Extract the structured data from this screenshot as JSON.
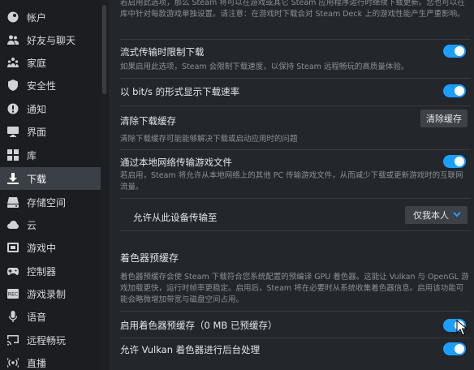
{
  "sidebar": {
    "items": [
      {
        "label": "帐户",
        "icon": "steam-logo-icon"
      },
      {
        "label": "好友与聊天",
        "icon": "friends-icon"
      },
      {
        "label": "家庭",
        "icon": "family-icon"
      },
      {
        "label": "安全性",
        "icon": "shield-icon"
      },
      {
        "label": "通知",
        "icon": "notification-icon"
      },
      {
        "label": "界面",
        "icon": "monitor-icon"
      },
      {
        "label": "库",
        "icon": "grid-icon"
      },
      {
        "label": "下载",
        "icon": "download-icon",
        "active": true
      },
      {
        "label": "存储空间",
        "icon": "drive-icon"
      },
      {
        "label": "云",
        "icon": "cloud-icon"
      },
      {
        "label": "游戏中",
        "icon": "in-game-icon"
      },
      {
        "label": "控制器",
        "icon": "controller-icon"
      },
      {
        "label": "游戏录制",
        "icon": "record-icon"
      },
      {
        "label": "语音",
        "icon": "microphone-icon"
      },
      {
        "label": "远程畅玩",
        "icon": "remote-play-icon"
      },
      {
        "label": "直播",
        "icon": "broadcast-icon"
      }
    ]
  },
  "settings": {
    "top_desc": "若启用此选项，那么 Steam 将可以在游戏或其它 Steam 应用程序运行时继续下载更新。您也可以在库中针对每款游戏单独设置。请注意：在游戏时下载会对 Steam Deck 上的游戏性能产生严重影响。",
    "stream_throttle": {
      "title": "流式传输时限制下载",
      "desc": "如果启用此选项，Steam 会限制下载速度，以保持 Steam 远程畅玩的高质量体验。"
    },
    "bits_display": {
      "title": "以 bit/s 的形式显示下载速率"
    },
    "clear_cache": {
      "title": "清除下载缓存",
      "button": "清除缓存",
      "desc": "清除下载缓存可能能够解决下载或启动应用时的问题"
    },
    "lan_transfer": {
      "title": "通过本地网络传输游戏文件",
      "desc": "若启用，Steam 将允许从本地网络上的其他 PC 传输游戏文件，从而减少下载或更新游戏时的互联网流量。"
    },
    "allow_transfer": {
      "title": "允许从此设备传输至",
      "value": "仅我本人"
    },
    "shader": {
      "section": "着色器预缓存",
      "desc": "着色器预缓存会使 Steam 下载符合您系统配置的预编译 GPU 着色器。这能让 Vulkan 与 OpenGL 游戏加载更快，运行时帧率更稳定。启用后，Steam 将在必要时从系统收集着色器信息。启用该功能可能会略微增加带宽与磁盘空间占用。",
      "enable_title": "启用着色器预缓存（0 MB 已预缓存）",
      "vulkan_title": "允许 Vulkan 着色器进行后台处理"
    }
  },
  "colors": {
    "accent": "#1a9fff",
    "background": "#23262b",
    "sidebar": "#1b1d21"
  }
}
